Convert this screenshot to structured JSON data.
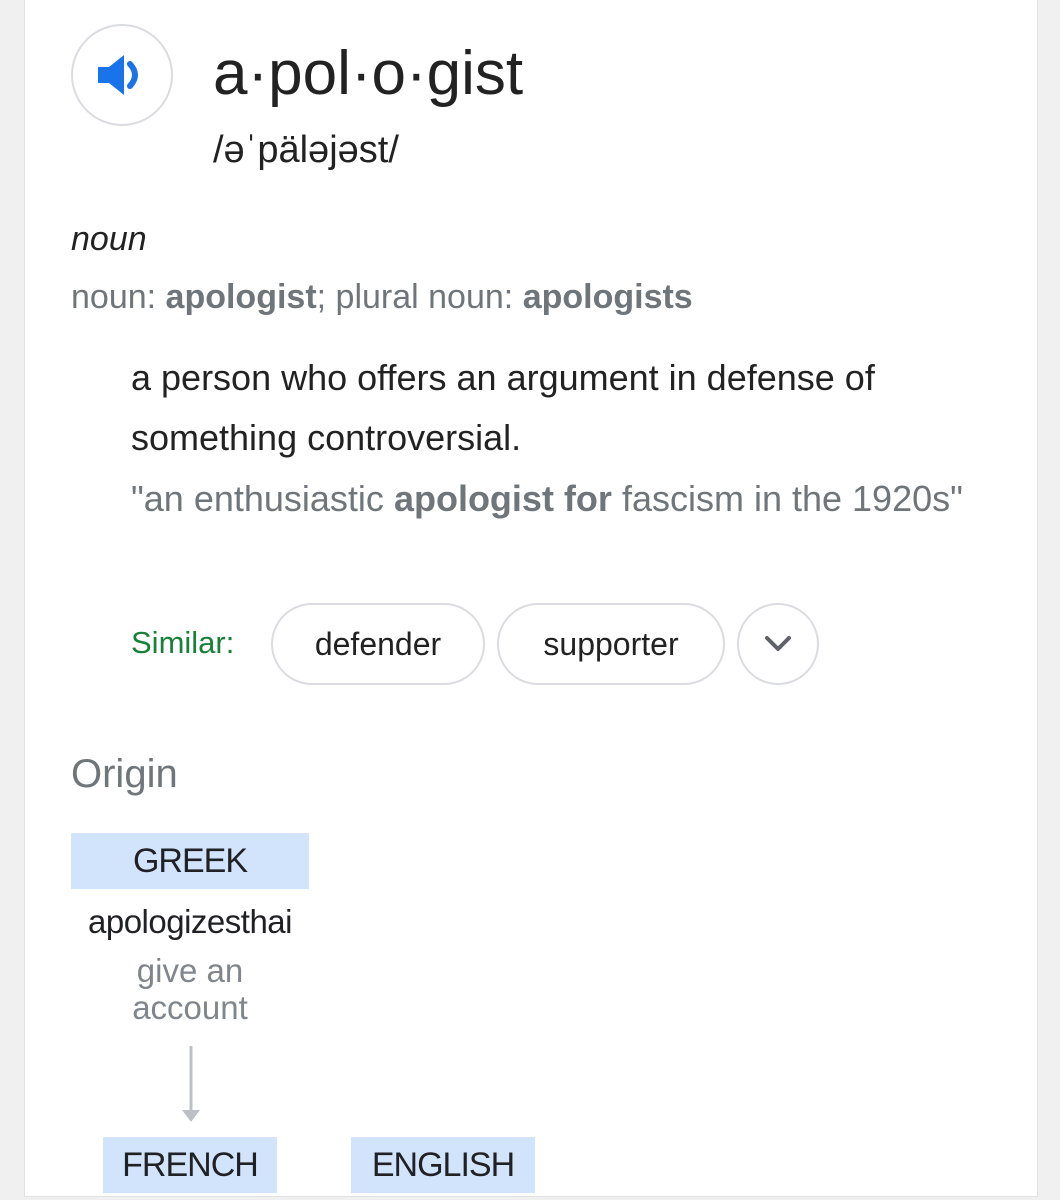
{
  "entry": {
    "word": "a·pol·o·gist",
    "phonetic": "/əˈpäləjəst/",
    "part_of_speech": "noun",
    "forms": {
      "noun_label": "noun: ",
      "noun_value": "apologist",
      "separator": "; ",
      "plural_label": "plural noun: ",
      "plural_value": "apologists"
    },
    "definition": "a person who offers an argument in defense of something controversial.",
    "example": {
      "prefix": "\"an enthusiastic ",
      "highlight": "apologist for",
      "suffix": " fascism in the 1920s\""
    },
    "similar": {
      "label": "Similar:",
      "items": [
        "defender",
        "supporter"
      ],
      "more_icon": "chevron-down-icon"
    }
  },
  "origin": {
    "heading": "Origin",
    "source_language": "GREEK",
    "source_word": "apologizesthai",
    "source_gloss": "give an account",
    "intermediate_language": "FRENCH",
    "target_language": "ENGLISH"
  },
  "icons": {
    "speaker": "speaker-icon"
  },
  "colors": {
    "speaker_blue": "#1a73e8",
    "similar_green": "#188038",
    "language_tag_bg": "#d2e3fc",
    "secondary_text": "#70757a"
  }
}
